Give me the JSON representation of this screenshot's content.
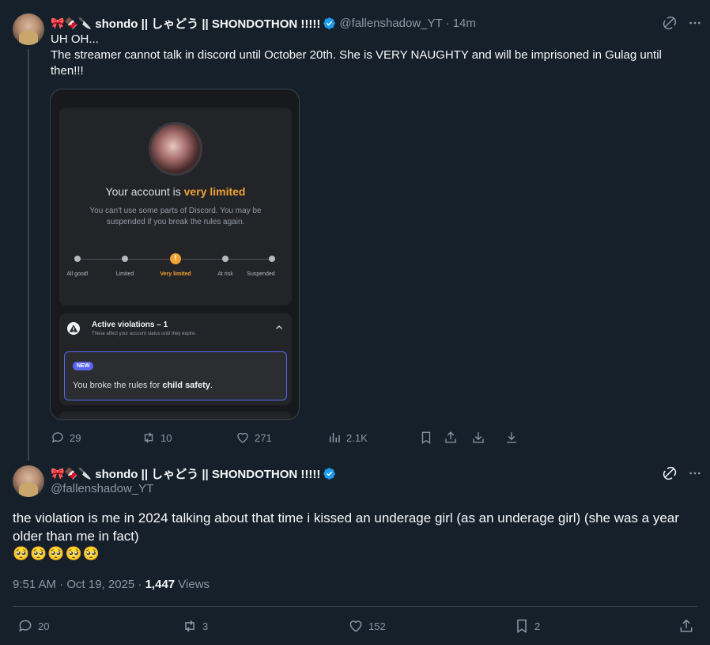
{
  "tweet1": {
    "name_emojis": "🎀🍫🔪",
    "display_name": "shondo || しゃどう || SHONDOTHON !!!!!",
    "handle": "@fallenshadow_YT",
    "separator": "·",
    "time": "14m",
    "text_line1": "UH OH...",
    "text_line2": "The streamer cannot talk in discord until October 20th. She is VERY NAUGHTY and will be imprisoned in Gulag until then!!!",
    "actions": {
      "replies": "29",
      "retweets": "10",
      "likes": "271",
      "views": "2.1K"
    }
  },
  "media": {
    "account_title_prefix": "Your account is ",
    "account_title_highlight": "very limited",
    "account_subtitle": "You can't use some parts of Discord. You may be suspended if you break the rules again.",
    "status_steps": [
      "All good!",
      "Limited",
      "Very limited",
      "At risk",
      "Suspended"
    ],
    "current_step": "Very limited",
    "violations_title": "Active violations – 1",
    "violations_subtitle": "These affect your account status until they expire.",
    "new_badge": "NEW",
    "violation_text_prefix": "You broke the rules for ",
    "violation_text_bold": "child safety",
    "violation_text_suffix": "."
  },
  "tweet2": {
    "name_emojis": "🎀🍫🔪",
    "display_name": "shondo || しゃどう || SHONDOTHON !!!!!",
    "handle": "@fallenshadow_YT",
    "text": "the violation is me in 2024 talking about that time i kissed an underage girl (as an underage girl) (she was a year older than me in fact)",
    "emojis": "🥺🥺🥺🥺🥺",
    "timestamp": "9:51 AM · Oct 19, 2025 · ",
    "views_count": "1,447",
    "views_label": " Views",
    "actions": {
      "replies": "20",
      "retweets": "3",
      "likes": "152",
      "bookmarks": "2"
    }
  },
  "colors": {
    "background": "#15202b",
    "text": "#f7f9f9",
    "muted": "#8b98a5",
    "verified": "#1d9bf0",
    "discord_warn": "#f0a232",
    "discord_blurple": "#5865f2"
  }
}
